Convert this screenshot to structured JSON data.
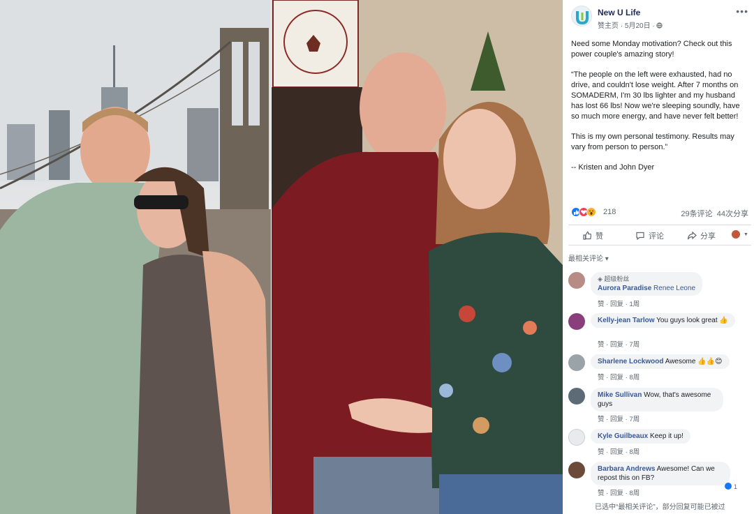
{
  "page": {
    "name": "New U Life",
    "meta": "赞主页 · 5月20日 · "
  },
  "post": {
    "paragraphs": [
      "Need some Monday motivation? Check out this power couple's amazing story!",
      "“The people on the left were exhausted, had no drive, and couldn't lose weight. After 7 months on SOMADERM, I'm 30 lbs lighter and my husband has lost 66 lbs! Now we're sleeping soundly, have so much more energy, and have never felt better!",
      "This is my own personal testimony. Results may vary from person to person.”",
      "-- Kristen and John Dyer"
    ]
  },
  "reactions": {
    "count": "218",
    "comments": "29条评论",
    "shares": "44次分享",
    "colors": {
      "like": "#1877f2",
      "love": "#f33e58",
      "wow": "#f7b125"
    }
  },
  "actions": {
    "like": "赞",
    "comment": "评论",
    "share": "分享"
  },
  "sort_label": "最相关评论 ▾",
  "comment_actions": {
    "like": "赞",
    "reply": "回复"
  },
  "comments": [
    {
      "badge": "超级粉丝",
      "name": "Aurora Paradise",
      "text": "Renee Leone",
      "time": "1周"
    },
    {
      "name": "Kelly-jean Tarlow",
      "text": "You guys look great 👍",
      "time": "7周"
    },
    {
      "name": "Sharlene Lockwood",
      "text": "Awesome 👍👍😊",
      "time": "8周"
    },
    {
      "name": "Mike Sullivan",
      "text": "Wow, that's awesome guys",
      "time": "7周"
    },
    {
      "name": "Kyle Guilbeaux",
      "text": "Keep it up!",
      "time": "8周"
    },
    {
      "name": "Barbara Andrews",
      "text": "Awesome! Can we repost this on FB?",
      "time": "8周",
      "likes": "1"
    }
  ],
  "footer": "已选中“最相关评论”，部分回复可能已被过"
}
